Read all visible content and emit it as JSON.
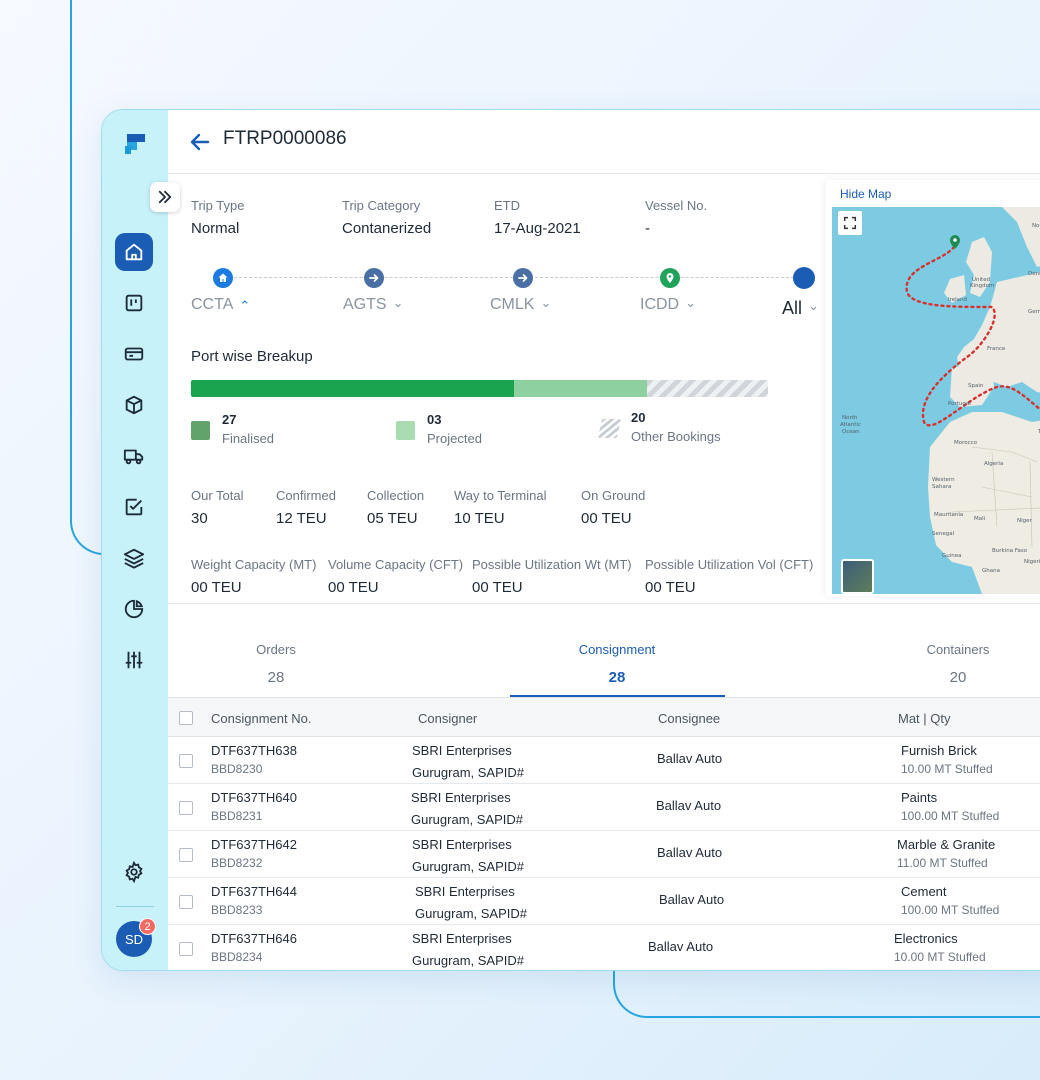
{
  "header": {
    "trip_id": "FTRP0000086"
  },
  "trip_info": [
    {
      "label": "Trip Type",
      "value": "Normal"
    },
    {
      "label": "Trip Category",
      "value": "Contanerized"
    },
    {
      "label": "ETD",
      "value": "17-Aug-2021"
    },
    {
      "label": "Vessel No.",
      "value": "-"
    }
  ],
  "route": {
    "stops": [
      {
        "name": "CCTA",
        "icon": "home-icon",
        "color": "#1b7be0",
        "chevron": "⌃"
      },
      {
        "name": "AGTS",
        "icon": "arrow-right-icon",
        "color": "#4a6fa5",
        "chevron": "⌄"
      },
      {
        "name": "CMLK",
        "icon": "arrow-right-icon",
        "color": "#4a6fa5",
        "chevron": "⌄"
      },
      {
        "name": "ICDD",
        "icon": "location-pin-icon",
        "color": "#21a35b",
        "chevron": "⌄"
      }
    ],
    "all_label": "All",
    "all_color": "#1b5db5"
  },
  "port_breakup": {
    "title": "Port wise Breakup",
    "finalised": {
      "count": "27",
      "label": "Finalised"
    },
    "projected": {
      "count": "03",
      "label": "Projected"
    },
    "other": {
      "count": "20",
      "label": "Other Bookings"
    }
  },
  "stats_row1": [
    {
      "label": "Our Total",
      "value": "30"
    },
    {
      "label": "Confirmed",
      "value": "12 TEU"
    },
    {
      "label": "Collection",
      "value": "05 TEU"
    },
    {
      "label": "Way to Terminal",
      "value": "10 TEU"
    },
    {
      "label": "On Ground",
      "value": "00 TEU"
    }
  ],
  "stats_row2": [
    {
      "label": "Weight Capacity (MT)",
      "value": "00 TEU"
    },
    {
      "label": "Volume Capacity (CFT)",
      "value": "00 TEU"
    },
    {
      "label": "Possible Utilization Wt (MT)",
      "value": "00 TEU"
    },
    {
      "label": "Possible Utilization Vol (CFT)",
      "value": "00 TEU"
    }
  ],
  "map": {
    "hide_label": "Hide Map",
    "labels": [
      "Norway",
      "United Kingdom",
      "Denmark",
      "Ireland",
      "Germany",
      "France",
      "Spain",
      "Portugal",
      "North Atlantic Ocean",
      "Morocco",
      "Tunisia",
      "Algeria",
      "Western Sahara",
      "Mauritania",
      "Mali",
      "Niger",
      "Senegal",
      "Guinea",
      "Burkina Faso",
      "Ghana",
      "Nigeria"
    ]
  },
  "tabs": [
    {
      "label": "Orders",
      "count": "28"
    },
    {
      "label": "Consignment",
      "count": "28"
    },
    {
      "label": "Containers",
      "count": "20"
    }
  ],
  "table": {
    "columns": [
      "Consignment No.",
      "Consigner",
      "Consignee",
      "Mat | Qty"
    ],
    "rows": [
      {
        "no": "DTF637TH638",
        "ref": "BBD8230",
        "consigner": "SBRI Enterprises",
        "location": "Gurugram, SAPID#",
        "consignee": "Ballav Auto",
        "material": "Furnish Brick",
        "qty": "10.00 MT Stuffed"
      },
      {
        "no": "DTF637TH640",
        "ref": "BBD8231",
        "consigner": "SBRI Enterprises",
        "location": "Gurugram, SAPID#",
        "consignee": "Ballav Auto",
        "material": "Paints",
        "qty": "100.00 MT Stuffed"
      },
      {
        "no": "DTF637TH642",
        "ref": "BBD8232",
        "consigner": "SBRI Enterprises",
        "location": "Gurugram, SAPID#",
        "consignee": "Ballav Auto",
        "material": "Marble & Granite",
        "qty": "11.00 MT Stuffed"
      },
      {
        "no": "DTF637TH644",
        "ref": "BBD8233",
        "consigner": "SBRI Enterprises",
        "location": "Gurugram, SAPID#",
        "consignee": "Ballav Auto",
        "material": "Cement",
        "qty": "100.00 MT Stuffed"
      },
      {
        "no": "DTF637TH646",
        "ref": "BBD8234",
        "consigner": "SBRI Enterprises",
        "location": "Gurugram, SAPID#",
        "consignee": "Ballav Auto",
        "material": "Electronics",
        "qty": "10.00 MT Stuffed"
      }
    ]
  },
  "user": {
    "initials": "SD",
    "notifications": "2"
  },
  "sidebar": {
    "items": [
      "home-icon",
      "board-icon",
      "card-icon",
      "package-icon",
      "truck-icon",
      "checklist-icon",
      "layers-icon",
      "pie-chart-icon",
      "sliders-icon"
    ],
    "settings_icon": "gear-icon"
  },
  "colors": {
    "accent": "#1b5db5",
    "finalised": "#1ba44f",
    "projected": "#8ed0a0",
    "sidebar_bg": "#c7f2fa"
  }
}
